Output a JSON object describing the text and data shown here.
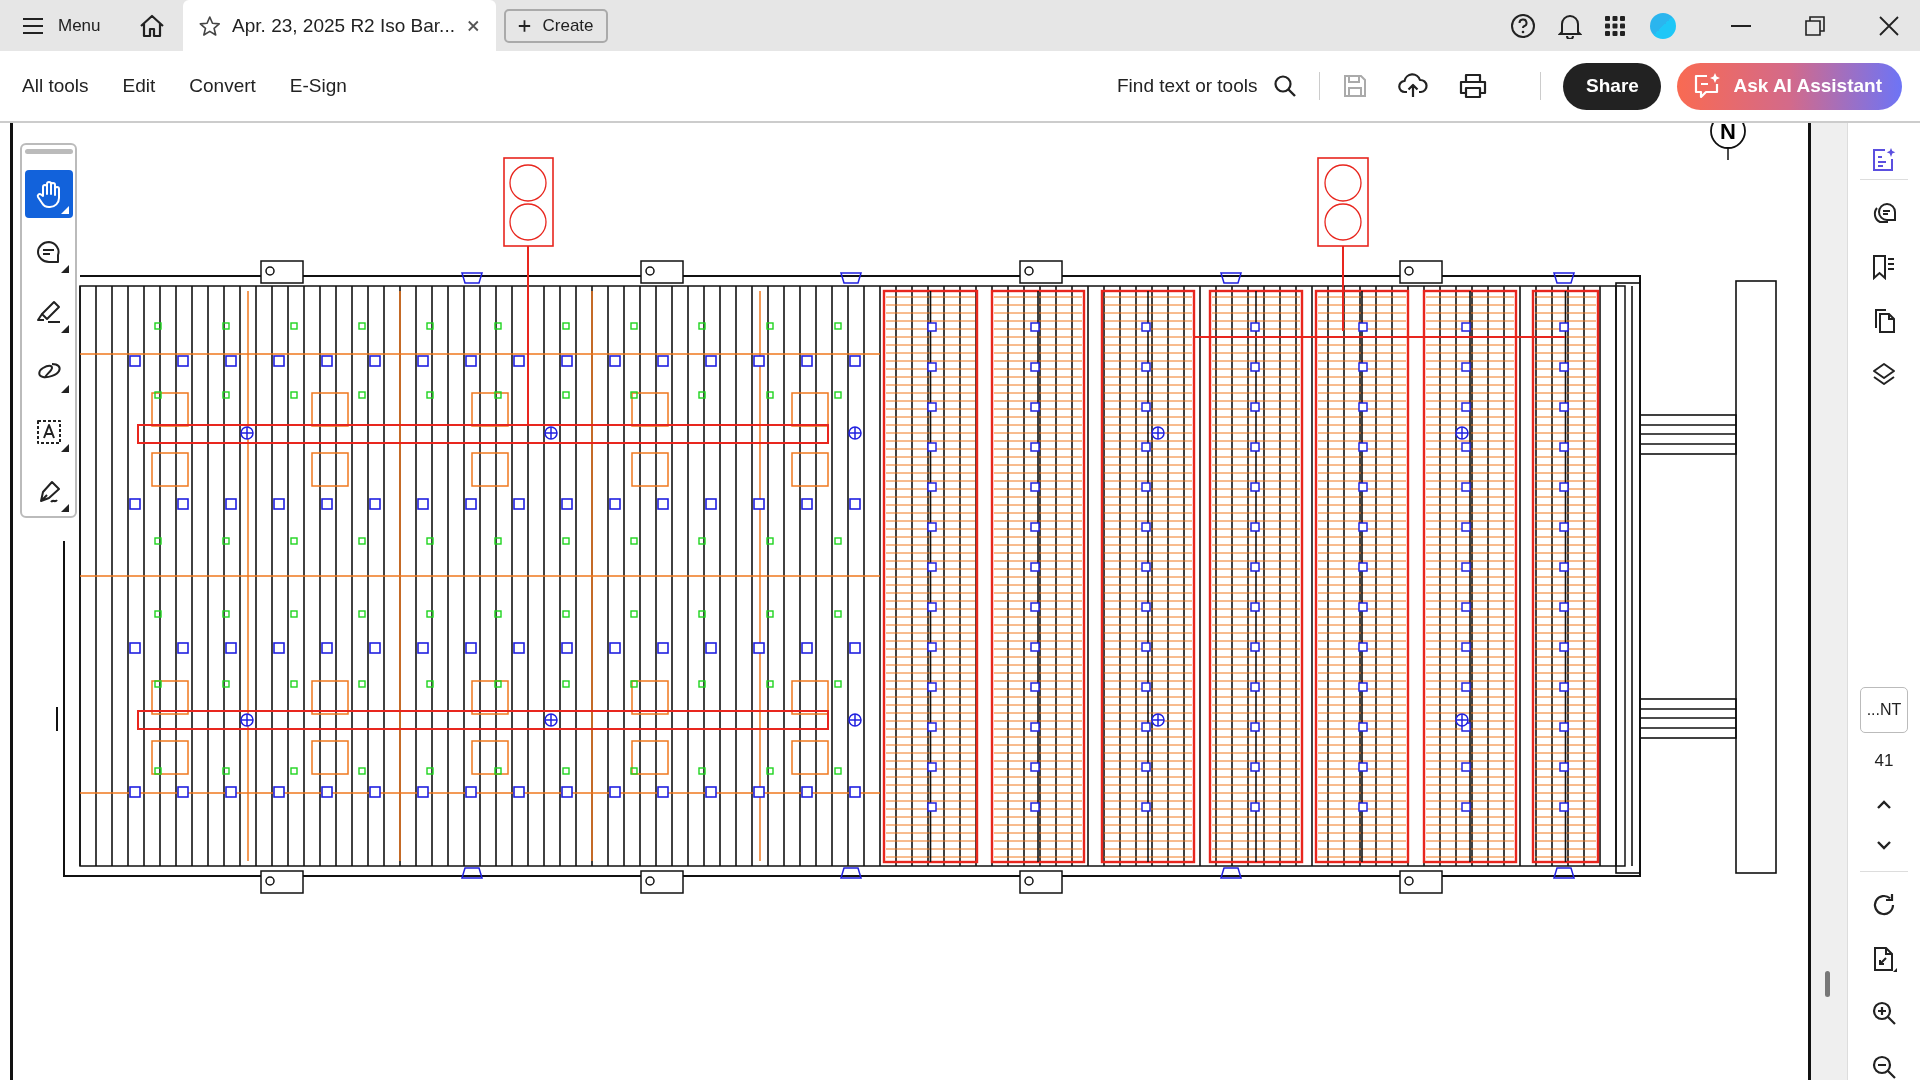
{
  "title_bar": {
    "menu_label": "Menu",
    "tab_title": "Apr. 23, 2025 R2 Iso Bar...",
    "create_label": "Create"
  },
  "toolbar": {
    "menu": [
      {
        "label": "All tools"
      },
      {
        "label": "Edit"
      },
      {
        "label": "Convert"
      },
      {
        "label": "E-Sign"
      }
    ],
    "search_label": "Find text or tools",
    "save_disabled": true,
    "share_label": "Share",
    "ai_label": "Ask AI Assistant"
  },
  "left_tools": [
    {
      "kind": "hand",
      "selected": true
    },
    {
      "kind": "comment",
      "selected": false
    },
    {
      "kind": "highlight",
      "selected": false
    },
    {
      "kind": "lasso",
      "selected": false
    },
    {
      "kind": "text",
      "selected": false
    },
    {
      "kind": "sign",
      "selected": false
    }
  ],
  "drawing": {
    "north_label": "N"
  },
  "right_panel": {
    "page_label": "...NT",
    "page_number": "41"
  }
}
